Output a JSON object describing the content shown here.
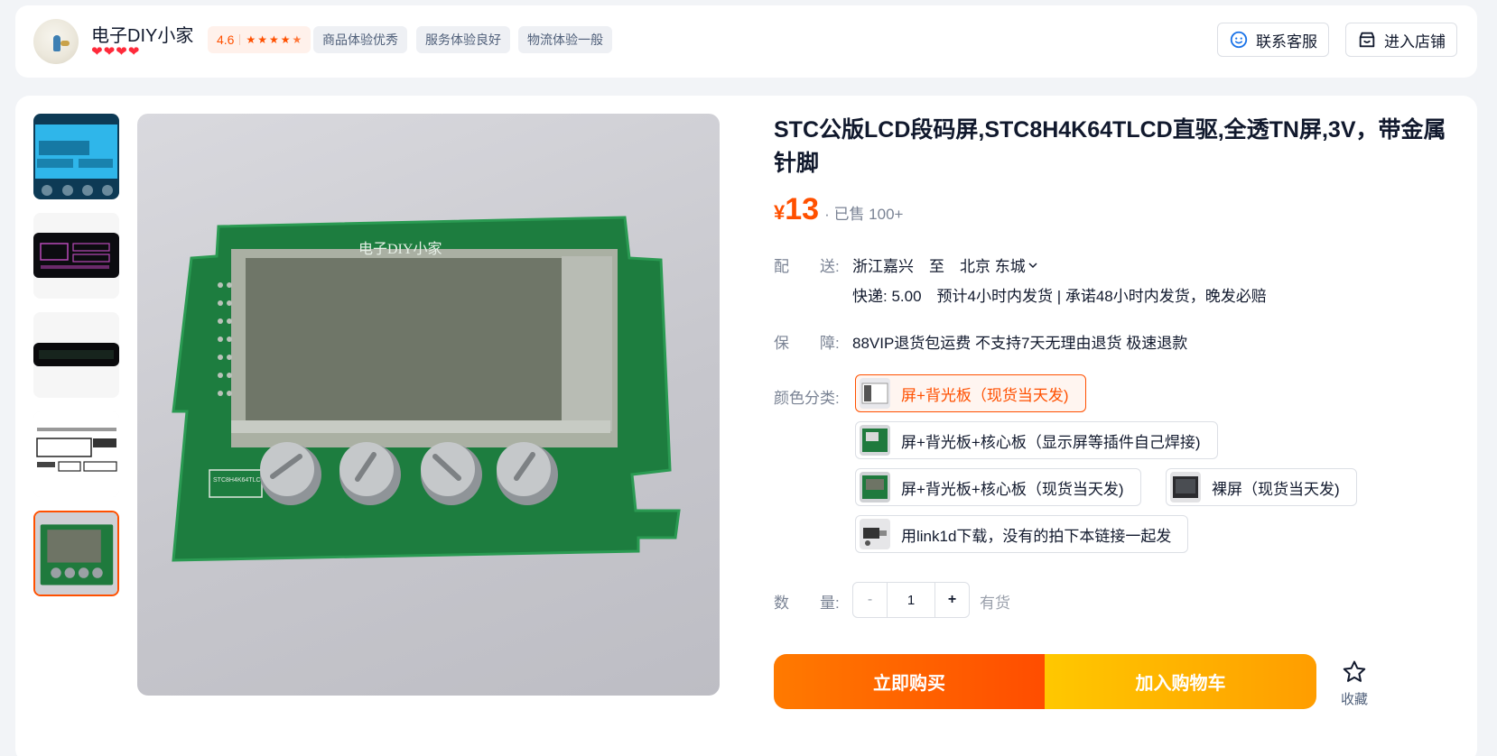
{
  "shop": {
    "name": "电子DIY小家",
    "hearts": [
      "❤",
      "❤",
      "❤",
      "❤"
    ],
    "rating": "4.6",
    "rating_stars": [
      "★",
      "★",
      "★",
      "★",
      "★"
    ],
    "tags": [
      "商品体验优秀",
      "服务体验良好",
      "物流体验一般"
    ],
    "contact_label": "联系客服",
    "store_label": "进入店铺"
  },
  "gallery": {
    "thumb_count": 5,
    "selected_index": 4
  },
  "product": {
    "title": "STC公版LCD段码屏,STC8H4K64TLCD直驱,全透TN屏,3V，带金属针脚",
    "currency": "¥",
    "price": "13",
    "sold": "· 已售 100+",
    "board_silk": "电子DIY小家",
    "board_label": "STC8H4K64TLCD"
  },
  "delivery": {
    "label": "配　　送:",
    "route": "浙江嘉兴　至　北京 东城",
    "detail": "快递: 5.00　预计4小时内发货 | 承诺48小时内发货，晚发必赔"
  },
  "guarantee": {
    "label": "保　　障:",
    "value": "88VIP退货包运费 不支持7天无理由退货 极速退款"
  },
  "sku": {
    "label": "颜色分类:",
    "options": [
      "屏+背光板（现货当天发)",
      "屏+背光板+核心板（显示屏等插件自己焊接)",
      "屏+背光板+核心板（现货当天发)",
      "裸屏（现货当天发)",
      "用link1d下载，没有的拍下本链接一起发"
    ],
    "selected_index": 0
  },
  "quantity": {
    "label": "数　　量:",
    "minus": "-",
    "value": "1",
    "plus": "+",
    "stock": "有货"
  },
  "actions": {
    "buy": "立即购买",
    "cart": "加入购物车",
    "favorite": "收藏"
  },
  "colors": {
    "accent": "#ff5000",
    "buy_gradient": [
      "#ff7a00",
      "#ff4d00"
    ],
    "cart_gradient": [
      "#ffc800",
      "#ff9d00"
    ],
    "heart": "#ff2a3a"
  }
}
